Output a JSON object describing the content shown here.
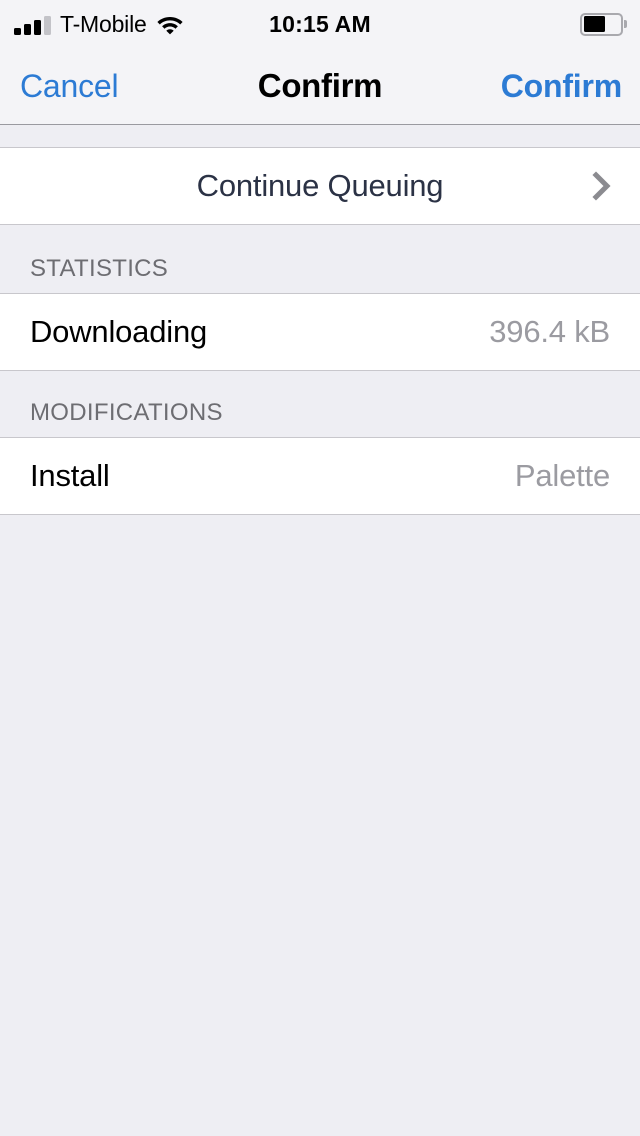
{
  "status_bar": {
    "carrier": "T-Mobile",
    "time": "10:15 AM",
    "signal_icon": "signal-bars-icon",
    "signal_bars_filled": 3,
    "signal_bars_total": 4,
    "wifi_icon": "wifi-icon",
    "battery_icon": "battery-icon",
    "battery_level_percent": 55
  },
  "nav_bar": {
    "cancel_label": "Cancel",
    "title": "Confirm",
    "confirm_label": "Confirm"
  },
  "rows": {
    "continue_queuing": {
      "label": "Continue Queuing",
      "disclosure_icon": "chevron-right-icon"
    }
  },
  "sections": [
    {
      "header": "STATISTICS",
      "rows": [
        {
          "label": "Downloading",
          "value": "396.4 kB"
        }
      ]
    },
    {
      "header": "MODIFICATIONS",
      "rows": [
        {
          "label": "Install",
          "value": "Palette"
        }
      ]
    }
  ],
  "colors": {
    "accent_blue": "#2c7bd4",
    "page_background": "#eeeef3",
    "cell_background": "#ffffff",
    "separator": "#c8c7cc",
    "secondary_text": "#9b9ba1",
    "section_header_text": "#6d6d72",
    "centered_title_text": "#2b3245"
  }
}
